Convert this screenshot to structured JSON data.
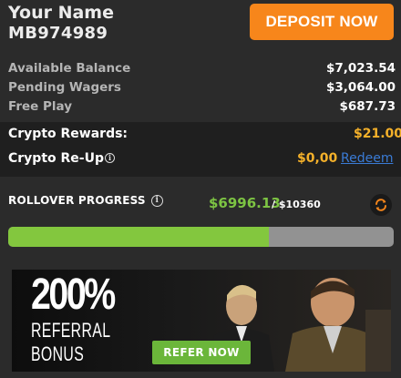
{
  "user": {
    "name": "Your Name",
    "id": "MB974989"
  },
  "header": {
    "deposit_label": "DEPOSIT NOW",
    "deposit_color": "#f7861b"
  },
  "balances": [
    {
      "label": "Available Balance",
      "value": "$7,023.54"
    },
    {
      "label": "Pending Wagers",
      "value": "$3,064.00"
    },
    {
      "label": "Free Play",
      "value": "$687.73"
    }
  ],
  "crypto": {
    "rewards_label": "Crypto Rewards:",
    "rewards_value": "$21.00",
    "reup_label": "Crypto Re-Up",
    "reup_value": "$0,00",
    "redeem_label": "Redeem",
    "value_color": "#f5b12a"
  },
  "rollover": {
    "label": "ROLLOVER PROGRESS",
    "amount": "$6996.13",
    "total": "/ $10360",
    "progress_fraction": 0.675,
    "fill_color": "#83c73e"
  },
  "banner": {
    "headline": "200%",
    "line1": "REFERRAL",
    "line2": "BONUS",
    "button_label": "REFER NOW"
  },
  "icons": {
    "info": "info-icon",
    "refresh": "refresh-icon"
  }
}
